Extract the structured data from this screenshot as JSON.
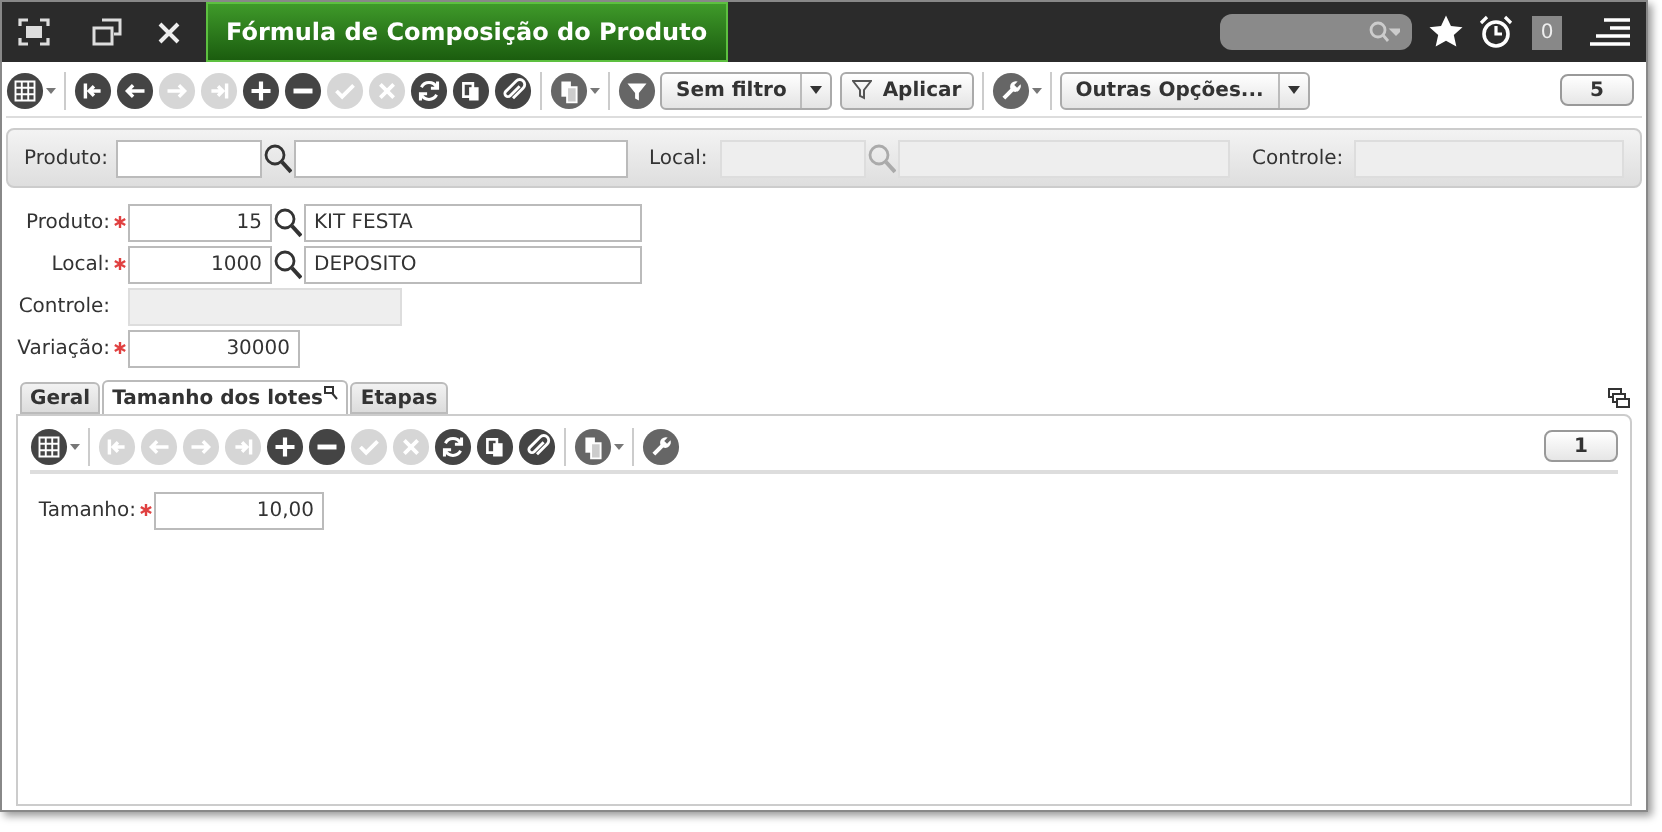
{
  "window": {
    "title": "Fórmula de Composição do Produto"
  },
  "header": {
    "notifications": "0"
  },
  "toolbar": {
    "items": [
      {
        "kind": "grid",
        "disabled": false,
        "dropdown": true
      },
      {
        "kind": "separator"
      },
      {
        "kind": "first",
        "disabled": false
      },
      {
        "kind": "prev",
        "disabled": false
      },
      {
        "kind": "next",
        "disabled": true
      },
      {
        "kind": "last",
        "disabled": true
      },
      {
        "kind": "add",
        "disabled": false
      },
      {
        "kind": "remove",
        "disabled": false
      },
      {
        "kind": "confirm",
        "disabled": true
      },
      {
        "kind": "cancel",
        "disabled": true
      },
      {
        "kind": "refresh",
        "disabled": false
      },
      {
        "kind": "copy",
        "disabled": false
      },
      {
        "kind": "attach",
        "disabled": false
      },
      {
        "kind": "separator"
      },
      {
        "kind": "report",
        "disabled": false,
        "dropdown": true
      },
      {
        "kind": "separator"
      },
      {
        "kind": "filter",
        "disabled": false
      },
      {
        "kind": "select",
        "label": "Sem filtro"
      },
      {
        "kind": "apply",
        "label": "Aplicar"
      },
      {
        "kind": "separator"
      },
      {
        "kind": "tools",
        "disabled": false,
        "dropdown": true
      },
      {
        "kind": "separator"
      },
      {
        "kind": "select",
        "label": "Outras Opções..."
      }
    ],
    "count": "5"
  },
  "filter_bar": {
    "fields": [
      {
        "label": "Produto:",
        "disabled": false,
        "lookup": true
      },
      {
        "label": "Local:",
        "disabled": true,
        "lookup": true
      },
      {
        "label": "Controle:",
        "disabled": true,
        "lookup": false
      }
    ]
  },
  "form": {
    "fields": [
      {
        "label": "Produto:",
        "required": true,
        "value": "15",
        "lookup": true,
        "description": "KIT FESTA",
        "disabled": false
      },
      {
        "label": "Local:",
        "required": true,
        "value": "1000",
        "lookup": true,
        "description": "DEPOSITO",
        "disabled": false
      },
      {
        "label": "Controle:",
        "required": false,
        "disabled": true,
        "lookup": false
      },
      {
        "label": "Variação:",
        "required": true,
        "value": "30000",
        "lookup": false,
        "disabled": false
      }
    ]
  },
  "tabs": [
    {
      "label": "Geral",
      "selected": false
    },
    {
      "label": "Tamanho dos lotes",
      "selected": true
    },
    {
      "label": "Etapas",
      "selected": false
    }
  ],
  "tab_toolbar": {
    "items": [
      {
        "kind": "grid",
        "disabled": false,
        "dropdown": true
      },
      {
        "kind": "separator"
      },
      {
        "kind": "first",
        "disabled": true
      },
      {
        "kind": "prev",
        "disabled": true
      },
      {
        "kind": "next",
        "disabled": true
      },
      {
        "kind": "last",
        "disabled": true
      },
      {
        "kind": "add",
        "disabled": false
      },
      {
        "kind": "remove",
        "disabled": false
      },
      {
        "kind": "confirm",
        "disabled": true
      },
      {
        "kind": "cancel",
        "disabled": true
      },
      {
        "kind": "refresh",
        "disabled": false
      },
      {
        "kind": "copy",
        "disabled": false
      },
      {
        "kind": "attach",
        "disabled": false
      },
      {
        "kind": "separator"
      },
      {
        "kind": "report",
        "disabled": false,
        "dropdown": true
      },
      {
        "kind": "separator"
      },
      {
        "kind": "tools",
        "disabled": false
      }
    ],
    "count": "1"
  },
  "tab_form": {
    "fields": [
      {
        "label": "Tamanho:",
        "required": true,
        "value": "10,00"
      }
    ]
  }
}
